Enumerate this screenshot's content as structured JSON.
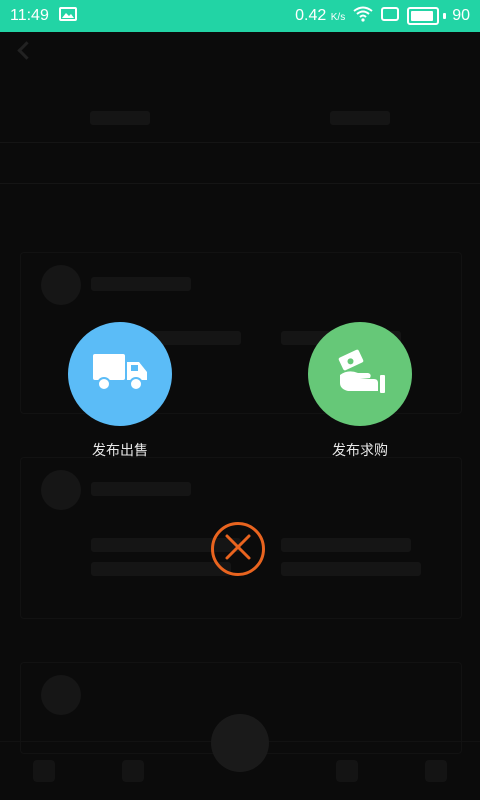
{
  "status_bar": {
    "time": "11:49",
    "network_speed": "0.42",
    "network_unit": "K/s",
    "battery_level": "90",
    "battery_fraction": 0.9
  },
  "actions": {
    "sell": {
      "label": "发布出售",
      "icon": "truck-icon",
      "color": "#5bbcf7"
    },
    "buy": {
      "label": "发布求购",
      "icon": "money-hand-icon",
      "color": "#66c878"
    }
  },
  "close": {
    "icon": "close-icon",
    "color": "#e9641f"
  }
}
